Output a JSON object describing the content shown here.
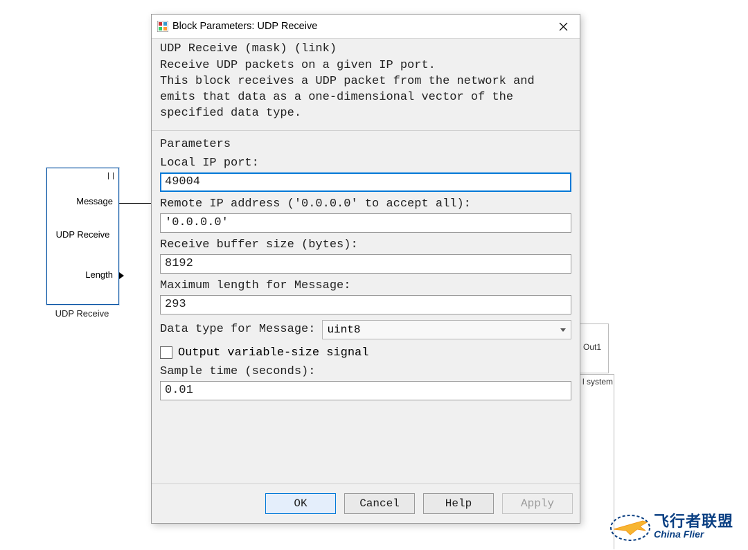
{
  "app_icon": "block-parameters-icon",
  "window_title": "Block Parameters: UDP Receive",
  "mask_header": "UDP Receive (mask) (link)",
  "mask_description": "Receive UDP packets on a given IP port.\nThis block receives a UDP packet from the network and emits that data as a one-dimensional vector of the specified data type.",
  "parameters": {
    "title": "Parameters",
    "local_ip_port": {
      "label": "Local IP port:",
      "value": "49004"
    },
    "remote_ip": {
      "label": "Remote IP address ('0.0.0.0' to accept all):",
      "value": "'0.0.0.0'"
    },
    "buffer_size": {
      "label": "Receive buffer size (bytes):",
      "value": "8192"
    },
    "max_length": {
      "label": "Maximum length for Message:",
      "value": "293"
    },
    "data_type": {
      "label": "Data type for Message:",
      "value": "uint8"
    },
    "output_varsize": {
      "label": "Output variable-size signal",
      "checked": false
    },
    "sample_time": {
      "label": "Sample time (seconds):",
      "value": "0.01"
    }
  },
  "buttons": {
    "ok": "OK",
    "cancel": "Cancel",
    "help": "Help",
    "apply": "Apply"
  },
  "canvas": {
    "block_center": "UDP Receive",
    "port_message": "Message",
    "port_length": "Length",
    "block_caption": "UDP Receive",
    "bg_out1": "Out1",
    "bg_system": "l system"
  },
  "logo": {
    "line1": "飞行者联盟",
    "line2": "China Flier"
  }
}
